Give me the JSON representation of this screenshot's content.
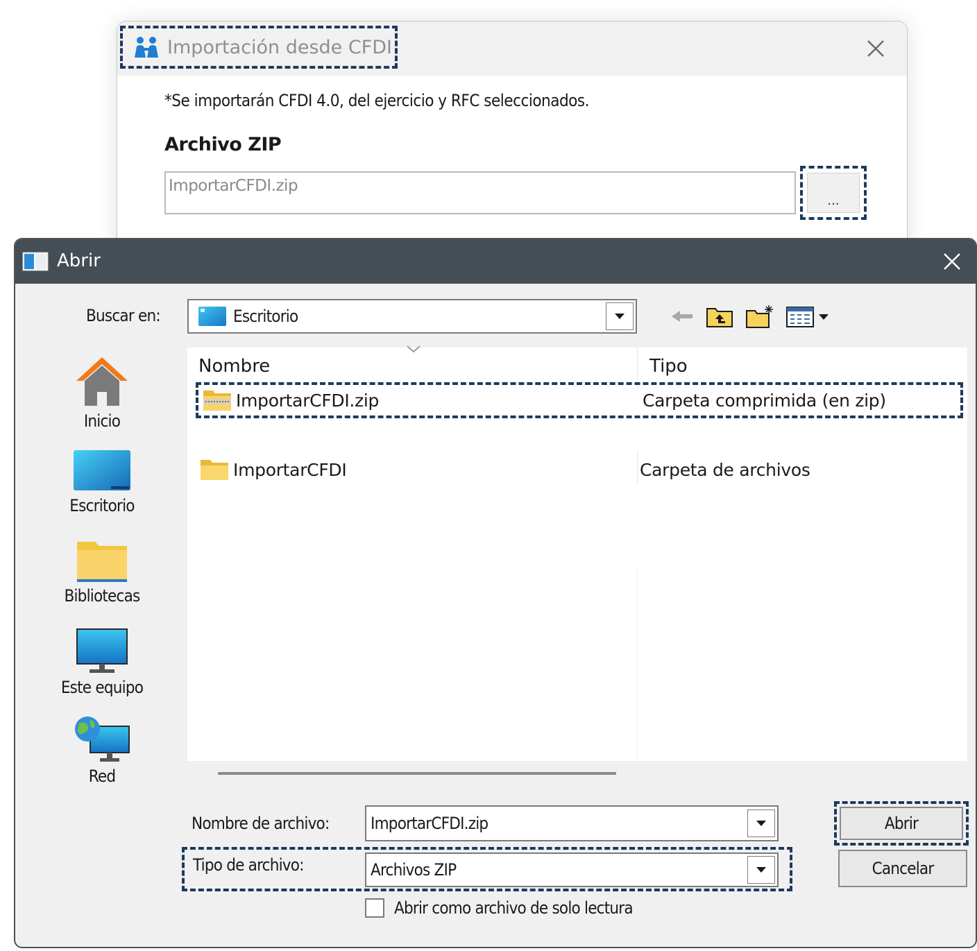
{
  "import_dialog": {
    "title": "Importación desde CFDI",
    "note": "*Se importarán CFDI 4.0, del ejercicio y RFC seleccionados.",
    "zip_label": "Archivo ZIP",
    "zip_value": "ImportarCFDI.zip",
    "browse_label": "...",
    "accent_color": "#1c3a5e"
  },
  "open_dialog": {
    "title": "Abrir",
    "look_in_label": "Buscar en:",
    "look_in_value": "Escritorio",
    "sidebar": [
      {
        "label": "Inicio",
        "icon": "home-icon"
      },
      {
        "label": "Escritorio",
        "icon": "desktop-icon"
      },
      {
        "label": "Bibliotecas",
        "icon": "libraries-folder-icon"
      },
      {
        "label": "Este equipo",
        "icon": "computer-icon"
      },
      {
        "label": "Red",
        "icon": "network-icon"
      }
    ],
    "columns": {
      "name": "Nombre",
      "type": "Tipo"
    },
    "files": [
      {
        "name": "ImportarCFDI.zip",
        "type": "Carpeta comprimida (en zip)",
        "icon": "zip-folder-icon",
        "selected": true
      },
      {
        "name": "ImportarCFDI",
        "type": "Carpeta de archivos",
        "icon": "folder-icon",
        "selected": false
      }
    ],
    "file_name_label": "Nombre de archivo:",
    "file_name_value": "ImportarCFDI.zip",
    "file_type_label": "Tipo de archivo:",
    "file_type_value": "Archivos ZIP",
    "readonly_label": "Abrir como archivo de solo lectura",
    "readonly_checked": false,
    "open_button": "Abrir",
    "cancel_button": "Cancelar",
    "titlebar_color": "#454e55"
  }
}
